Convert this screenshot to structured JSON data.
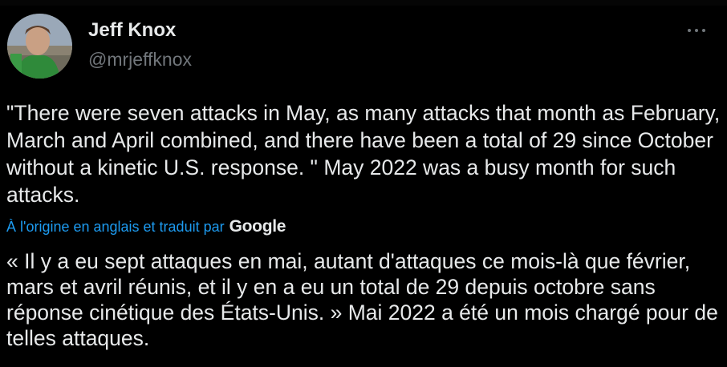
{
  "author": {
    "name": "Jeff Knox",
    "handle": "@mrjeffknox"
  },
  "tweet": {
    "text": "\"There were seven attacks in May, as many attacks that month as February, March and April combined, and there have been a total of 29 since October without a kinetic U.S. response. \" May 2022 was a busy month for such attacks."
  },
  "translation": {
    "label": "À l'origine en anglais et traduit par",
    "provider": "Google",
    "text": "« Il y a eu sept attaques en mai, autant d'attaques ce mois-là que février, mars et avril réunis, et il y en a eu un total de 29 depuis octobre sans réponse cinétique des États-Unis. » Mai 2022 a été un mois chargé pour de telles attaques."
  },
  "icons": {
    "more": "more-horizontal-icon",
    "avatar": "profile-photo"
  },
  "colors": {
    "background": "#000000",
    "text": "#e7e9ea",
    "secondary": "#71767b",
    "link": "#1d9bf0"
  }
}
